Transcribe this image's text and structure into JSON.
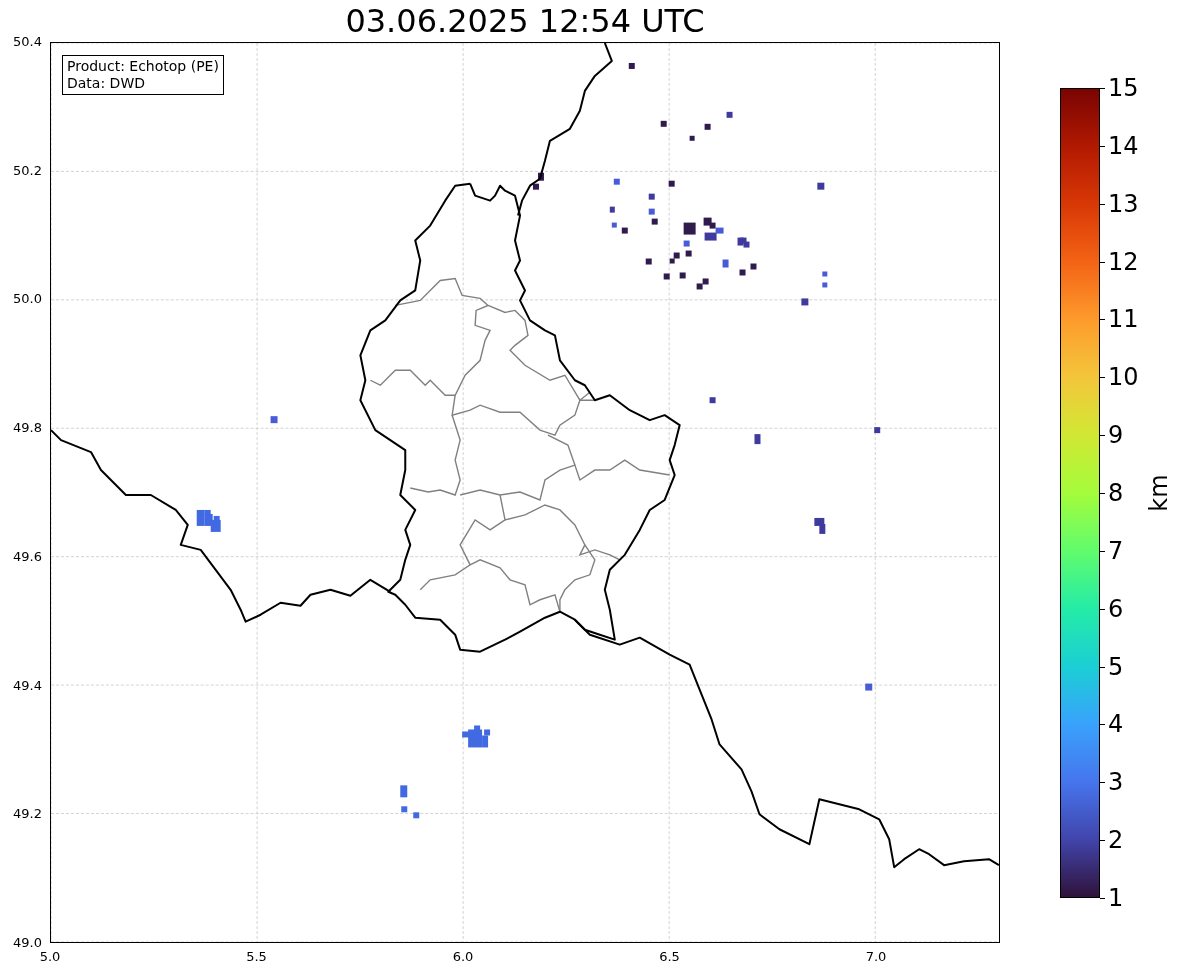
{
  "title": "03.06.2025 12:54 UTC",
  "legend": [
    "Product: Echotop (PE)",
    "Data: DWD"
  ],
  "map": {
    "xticks": [
      "5.0",
      "5.5",
      "6.0",
      "6.5",
      "7.0"
    ],
    "yticks": [
      "50.4",
      "50.2",
      "50.0",
      "49.8",
      "49.6",
      "49.4",
      "49.2",
      "49.0"
    ]
  },
  "colorbar": {
    "label": "km",
    "ticks": [
      "15",
      "14",
      "13",
      "12",
      "11",
      "10",
      "9",
      "8",
      "7",
      "6",
      "5",
      "4",
      "3",
      "2",
      "1"
    ]
  }
}
